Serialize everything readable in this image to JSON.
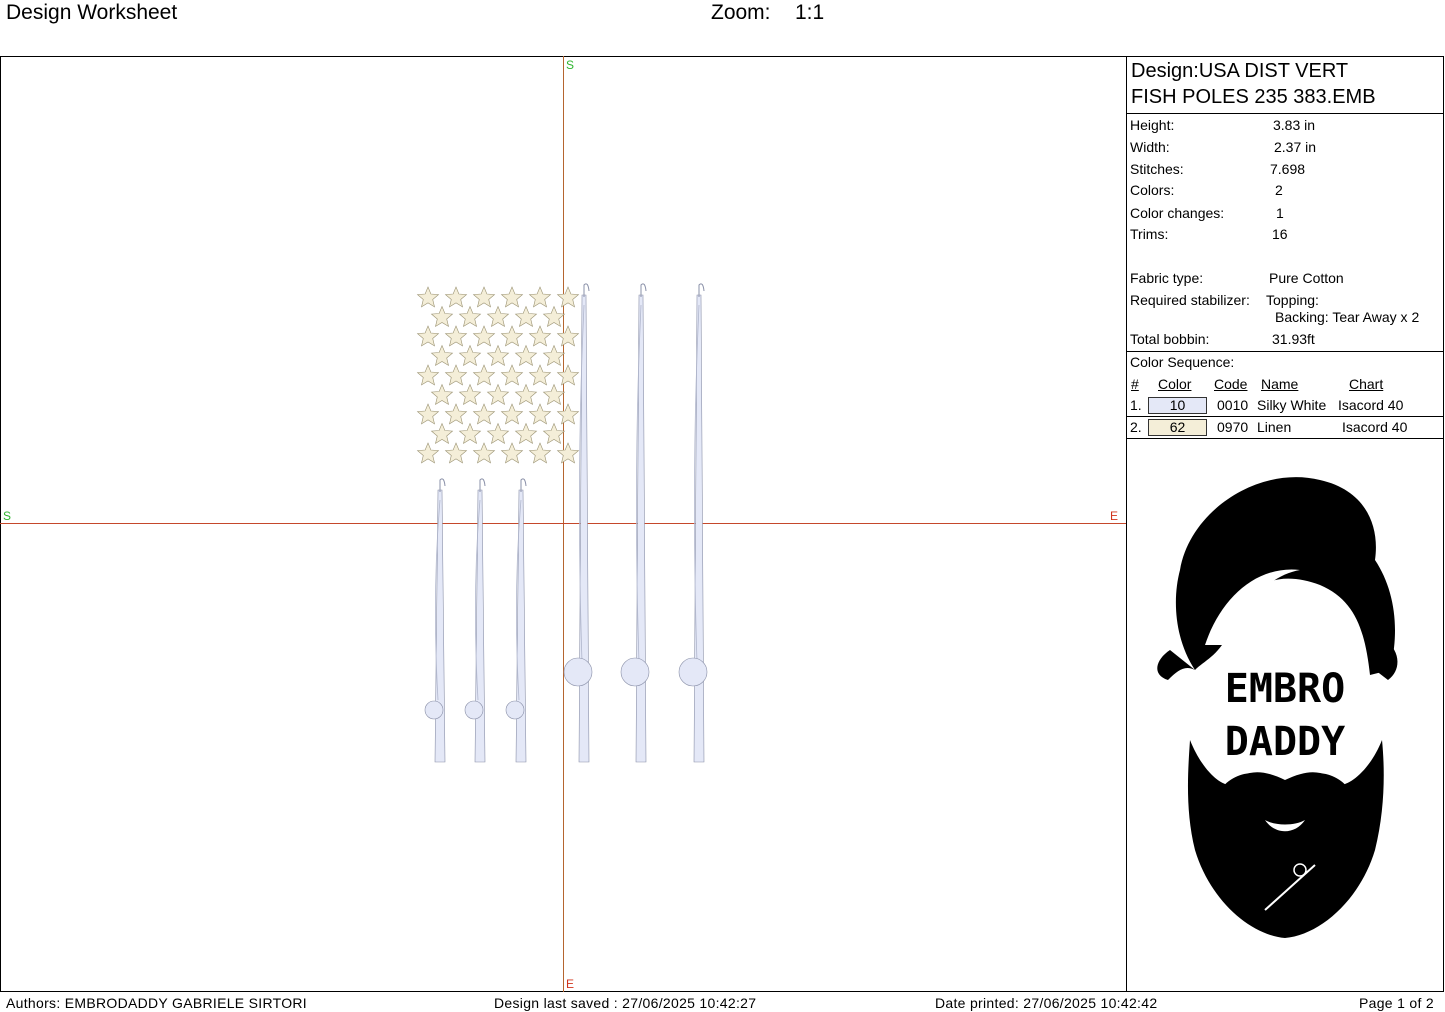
{
  "header": {
    "title": "Design Worksheet",
    "zoom_label": "Zoom:",
    "zoom_value": "1:1"
  },
  "canvas": {
    "axis_labels": {
      "top": "S",
      "left": "S",
      "right": "E",
      "bottom": "E"
    }
  },
  "design": {
    "name": "Design:USA DIST VERT FISH POLES 235 383.EMB",
    "name_line1": "Design:USA DIST VERT",
    "name_line2": "FISH POLES 235 383.EMB",
    "properties": [
      {
        "label": "Height:",
        "value": "3.83 in"
      },
      {
        "label": "Width:",
        "value": "2.37 in"
      },
      {
        "label": "Stitches:",
        "value": "7.698"
      },
      {
        "label": "Colors:",
        "value": "2"
      },
      {
        "label": "Color changes:",
        "value": "1"
      },
      {
        "label": "Trims:",
        "value": "16"
      }
    ],
    "fabric_type_label": "Fabric type:",
    "fabric_type": "Pure Cotton",
    "stabilizer_label": "Required stabilizer:",
    "topping": "Topping:",
    "backing": "Backing: Tear Away x 2",
    "bobbin_label": "Total bobbin:",
    "bobbin": "31.93ft"
  },
  "color_sequence": {
    "title": "Color Sequence:",
    "headers": {
      "num": "#",
      "color": "Color",
      "code": "Code",
      "name": "Name",
      "chart": "Chart"
    },
    "rows": [
      {
        "num": "1.",
        "color": "10",
        "code": "0010",
        "name": "Silky White",
        "chart": "Isacord 40",
        "swatch": "#e4e8f7"
      },
      {
        "num": "2.",
        "color": "62",
        "code": "0970",
        "name": "Linen",
        "chart": "Isacord 40",
        "swatch": "#f4eed8"
      }
    ]
  },
  "logo": {
    "line1": "EMBRO",
    "line2": "DADDY"
  },
  "footer": {
    "authors": "Authors: EMBRODADDY GABRIELE SIRTORI",
    "saved": "Design last saved : 27/06/2025 10:42:27",
    "printed": "Date printed: 27/06/2025 10:42:42",
    "page": "Page 1 of 2"
  },
  "colors": {
    "axis_vertical": "#b5652f",
    "axis_horizontal": "#c5482b",
    "axis_label_s": "#2fb52f",
    "axis_label_e": "#d0341c",
    "star_fill": "#f4eed8",
    "pole_fill": "#e4e8f7"
  }
}
